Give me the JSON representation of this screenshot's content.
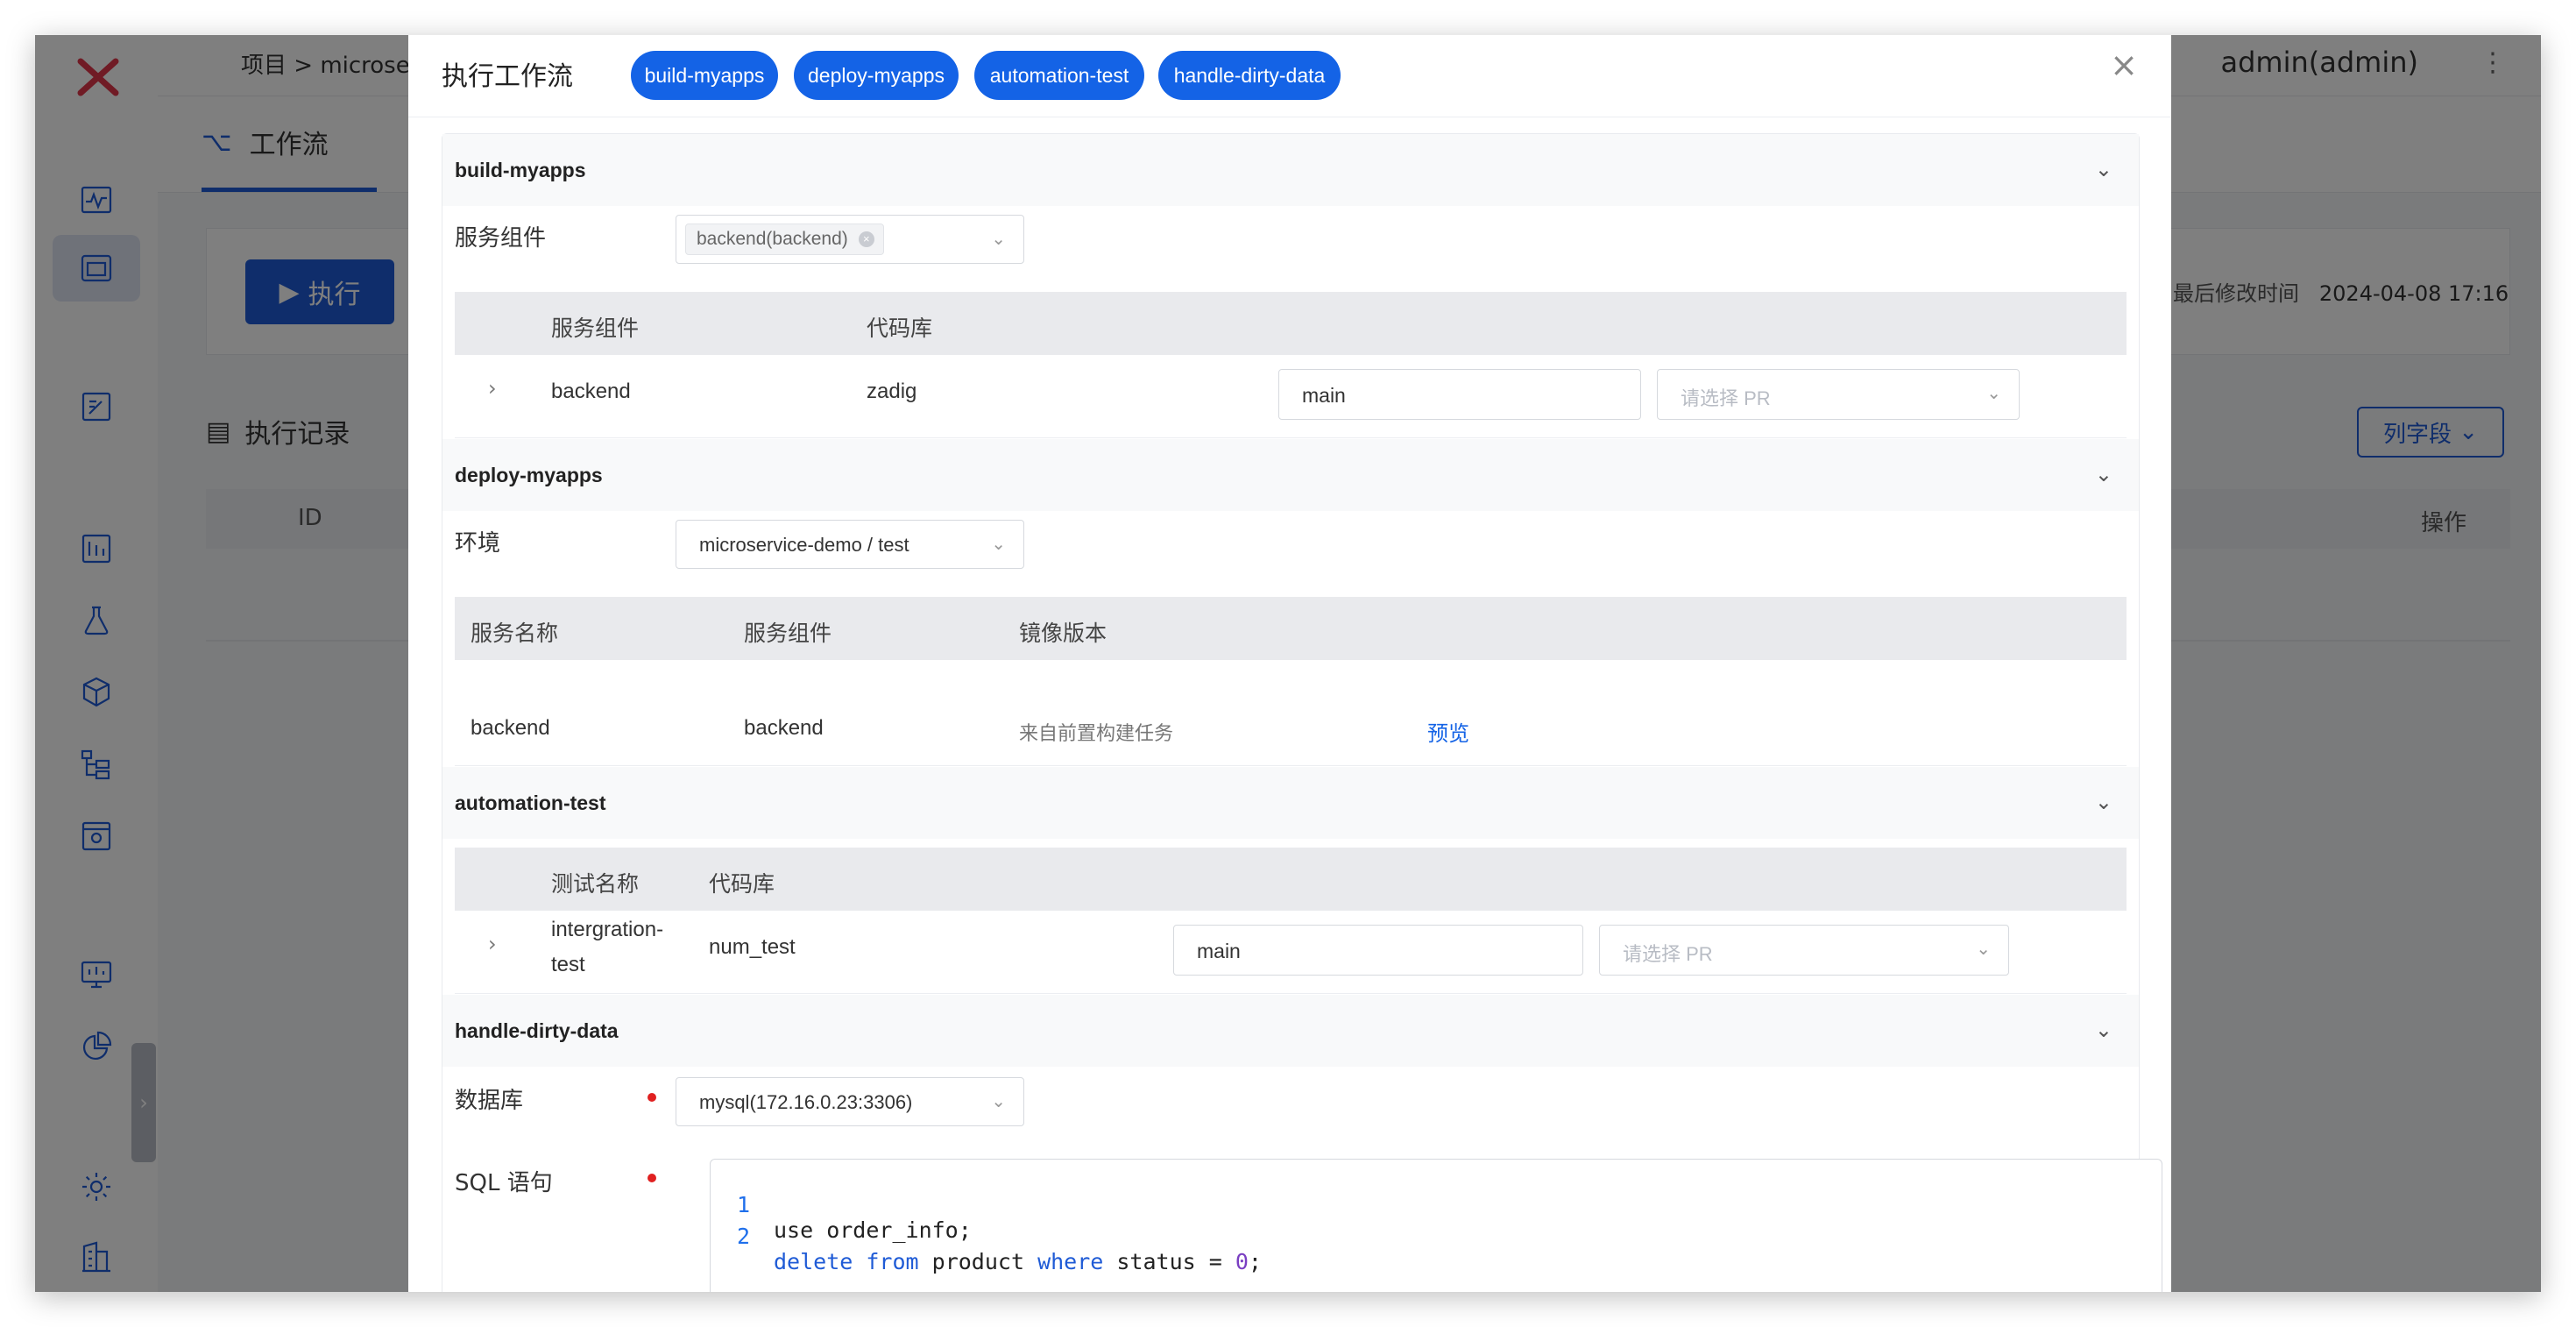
{
  "app": {
    "breadcrumb": "项目  >  microservic",
    "user": "admin(admin)",
    "workflow_tab": "工作流",
    "execute_button": "执行",
    "last_modified_label": "最后修改时间",
    "last_modified_value": "2024-04-08 17:16",
    "exec_records_title": "执行记录",
    "columns_button": "列字段",
    "table_id_header": "ID",
    "table_ops_header": "操作"
  },
  "modal": {
    "title": "执行工作流",
    "pills": [
      "build-myapps",
      "deploy-myapps",
      "automation-test",
      "handle-dirty-data"
    ],
    "sections": {
      "build": {
        "name": "build-myapps",
        "service_label": "服务组件",
        "service_tag": "backend(backend)",
        "headers": [
          "服务组件",
          "代码库"
        ],
        "row": {
          "service": "backend",
          "repo": "zadig",
          "branch": "main",
          "pr_placeholder": "请选择 PR"
        }
      },
      "deploy": {
        "name": "deploy-myapps",
        "env_label": "环境",
        "env_value": "microservice-demo / test",
        "headers": [
          "服务名称",
          "服务组件",
          "镜像版本"
        ],
        "row": {
          "service_name": "backend",
          "service_component": "backend",
          "image": "来自前置构建任务",
          "preview": "预览"
        }
      },
      "test": {
        "name": "automation-test",
        "headers": [
          "测试名称",
          "代码库"
        ],
        "row": {
          "test_name_1": "intergration-",
          "test_name_2": "test",
          "repo": "num_test",
          "branch": "main",
          "pr_placeholder": "请选择 PR"
        }
      },
      "dirty": {
        "name": "handle-dirty-data",
        "db_label": "数据库",
        "db_value": "mysql(172.16.0.23:3306)",
        "sql_label": "SQL 语句",
        "sql_lines": [
          {
            "no": "1",
            "text": "use order_info;"
          },
          {
            "no": "2",
            "kw1": "delete",
            "kw2": "from",
            "mid": " product ",
            "kw3": "where",
            "tail": " status = ",
            "num": "0",
            "end": ";"
          }
        ]
      }
    }
  },
  "colors": {
    "primary": "#1463e6",
    "required": "#e02020"
  }
}
